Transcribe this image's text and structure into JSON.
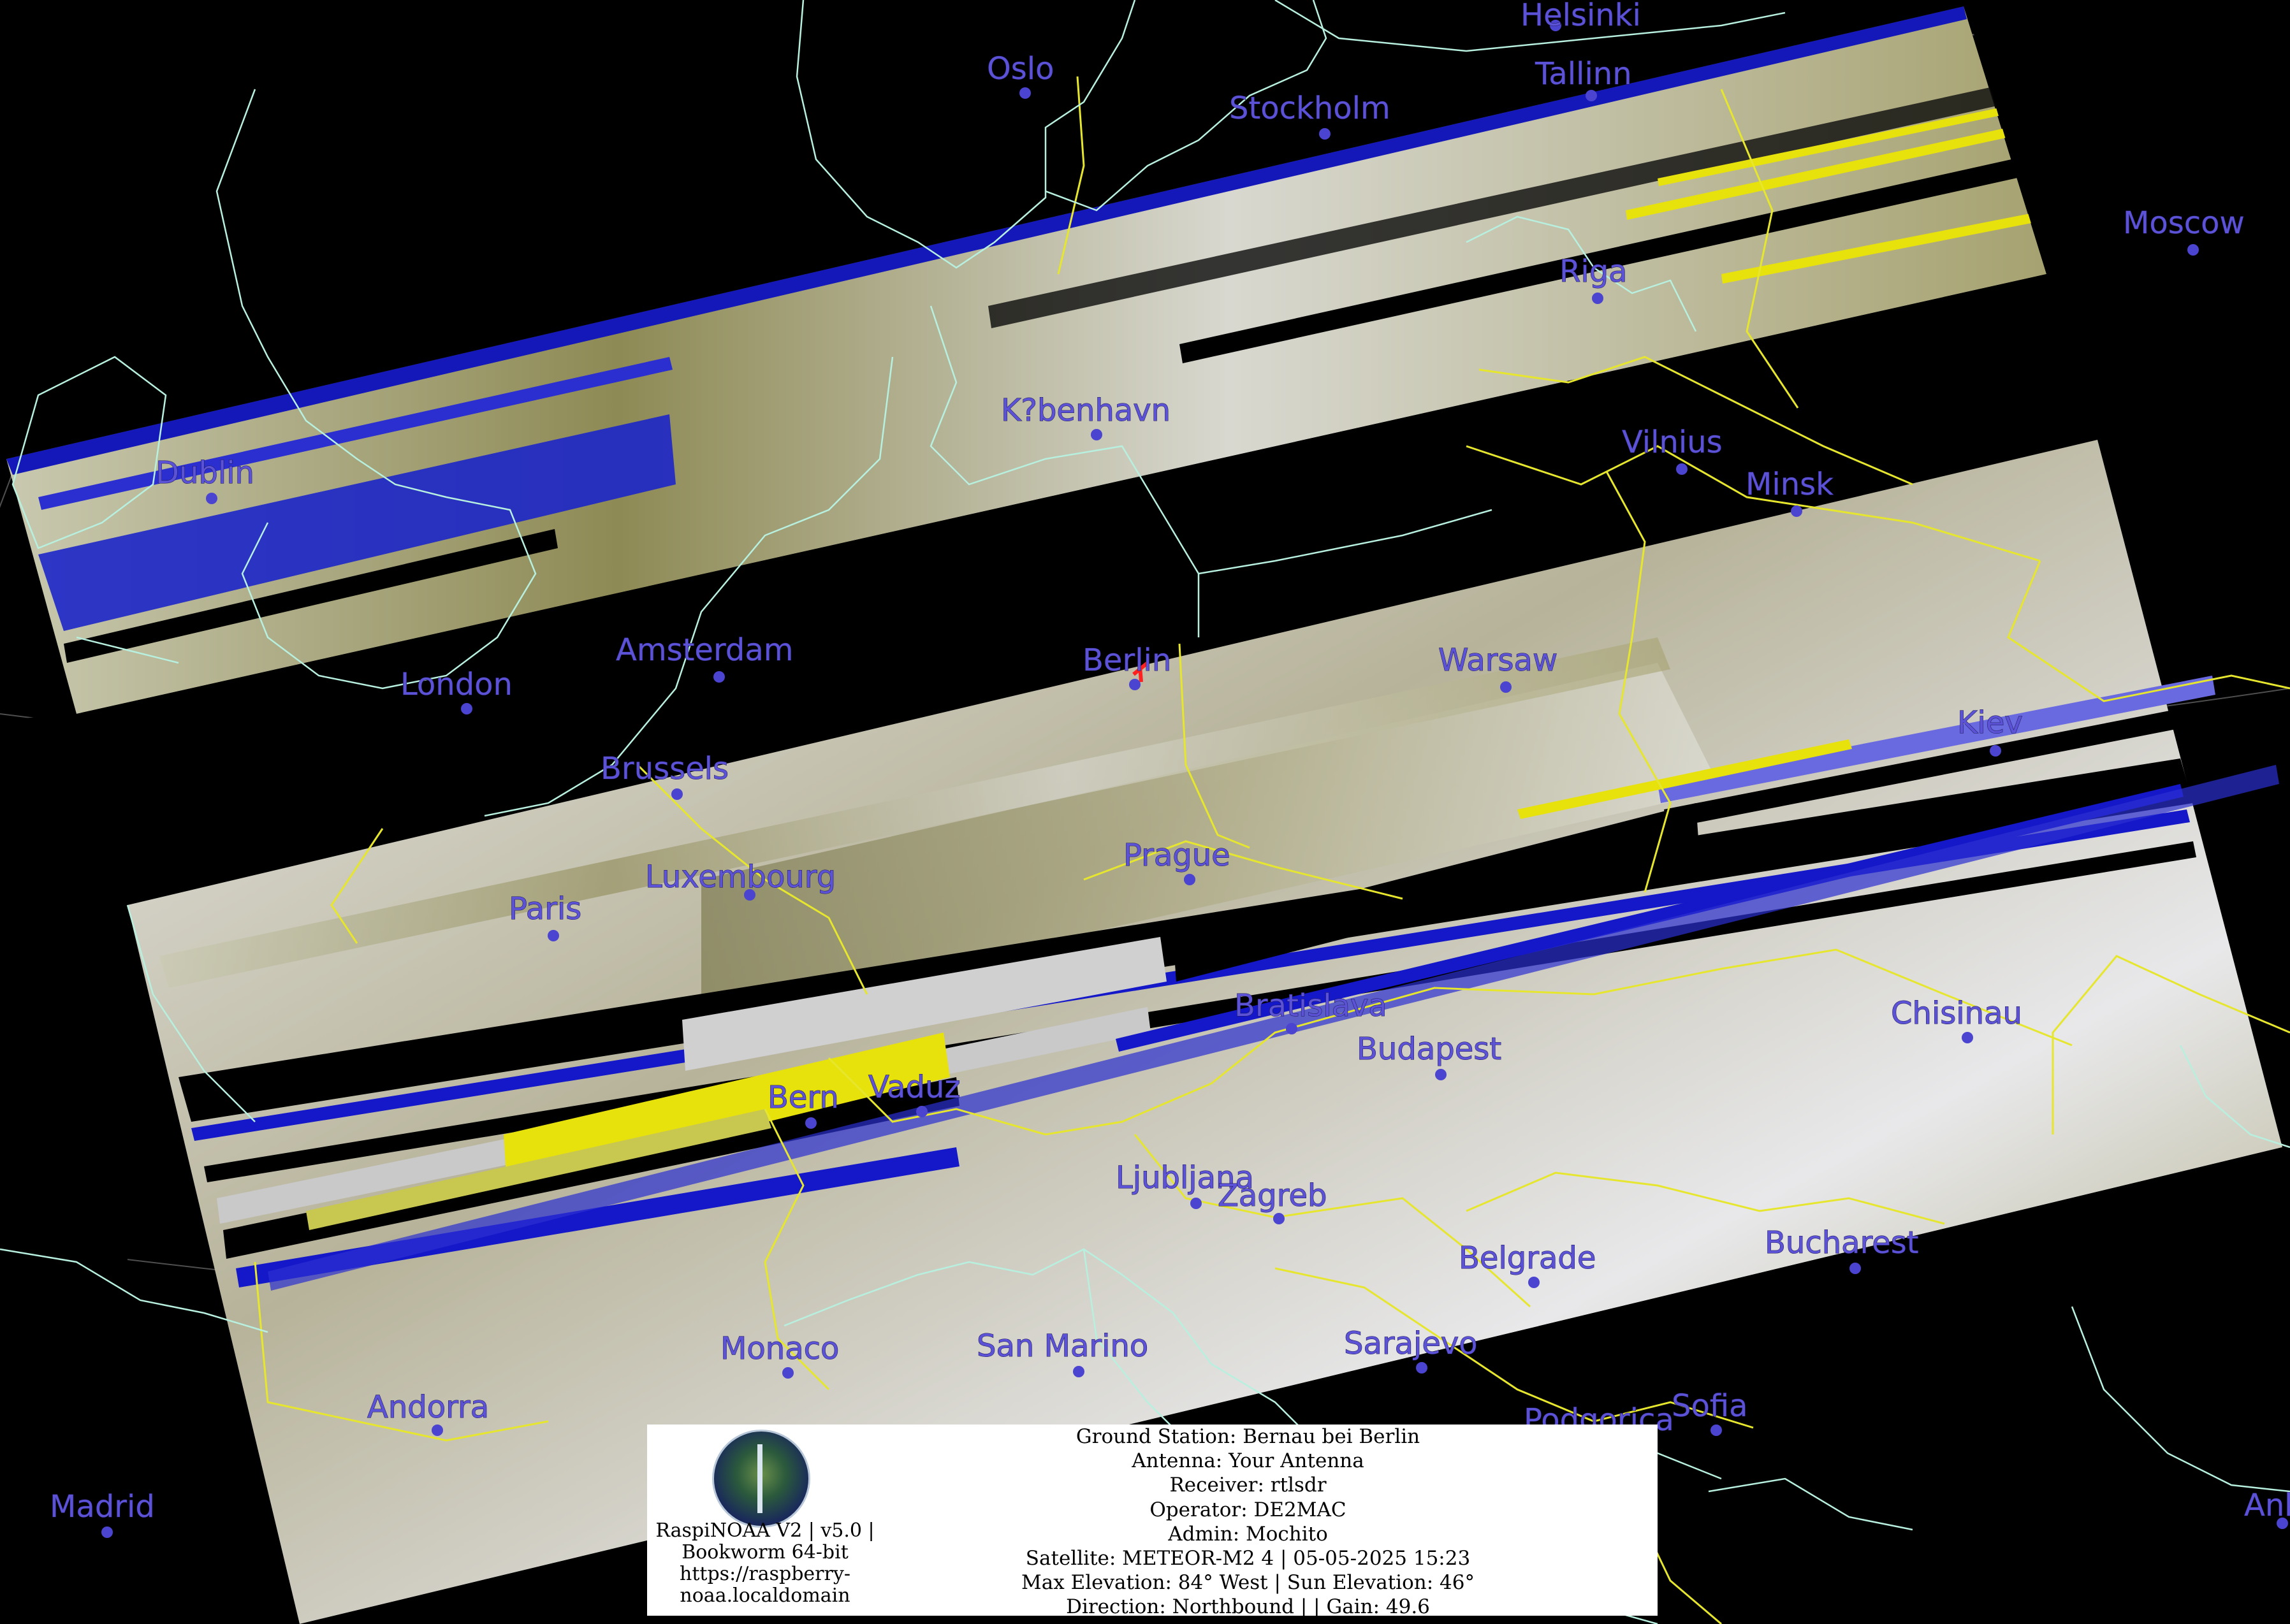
{
  "cities": [
    {
      "name": "Helsinki"
    },
    {
      "name": "Oslo"
    },
    {
      "name": "Tallinn"
    },
    {
      "name": "Stockholm"
    },
    {
      "name": "Moscow"
    },
    {
      "name": "Riga"
    },
    {
      "name": "K?benhavn"
    },
    {
      "name": "Vilnius"
    },
    {
      "name": "Dublin"
    },
    {
      "name": "Minsk"
    },
    {
      "name": "Amsterdam"
    },
    {
      "name": "Berlin"
    },
    {
      "name": "Warsaw"
    },
    {
      "name": "London"
    },
    {
      "name": "Kiev"
    },
    {
      "name": "Brussels"
    },
    {
      "name": "Luxembourg"
    },
    {
      "name": "Prague"
    },
    {
      "name": "Paris"
    },
    {
      "name": "Bratislava"
    },
    {
      "name": "Chisinau"
    },
    {
      "name": "Budapest"
    },
    {
      "name": "Bern"
    },
    {
      "name": "Vaduz"
    },
    {
      "name": "Ljubljana"
    },
    {
      "name": "Zagreb"
    },
    {
      "name": "Belgrade"
    },
    {
      "name": "Bucharest"
    },
    {
      "name": "Monaco"
    },
    {
      "name": "San Marino"
    },
    {
      "name": "Sarajevo"
    },
    {
      "name": "Andorra"
    },
    {
      "name": "Sofia"
    },
    {
      "name": "Podgorica"
    },
    {
      "name": "Madrid"
    },
    {
      "name": "Ankara"
    }
  ],
  "infobox": {
    "software": "RaspiNOAA V2 | v5.0 |",
    "os": "Bookworm 64-bit",
    "url_line1": "https://raspberry-",
    "url_line2": "noaa.localdomain",
    "ground_station": "Ground Station: Bernau bei Berlin",
    "antenna": "Antenna: Your Antenna",
    "receiver": "Receiver: rtlsdr",
    "operator": "Operator: DE2MAC",
    "admin": "Admin: Mochito",
    "satellite": "Satellite: METEOR-M2 4 | 05-05-2025 15:23",
    "elevation": "Max Elevation: 84° West | Sun Elevation: 46°",
    "direction": "Direction: Northbound | | Gain: 49.6"
  },
  "colors": {
    "city_label": "#5b52d6",
    "borders": "#e6e62e",
    "coastline": "#b8f0e0",
    "background": "#000000"
  }
}
